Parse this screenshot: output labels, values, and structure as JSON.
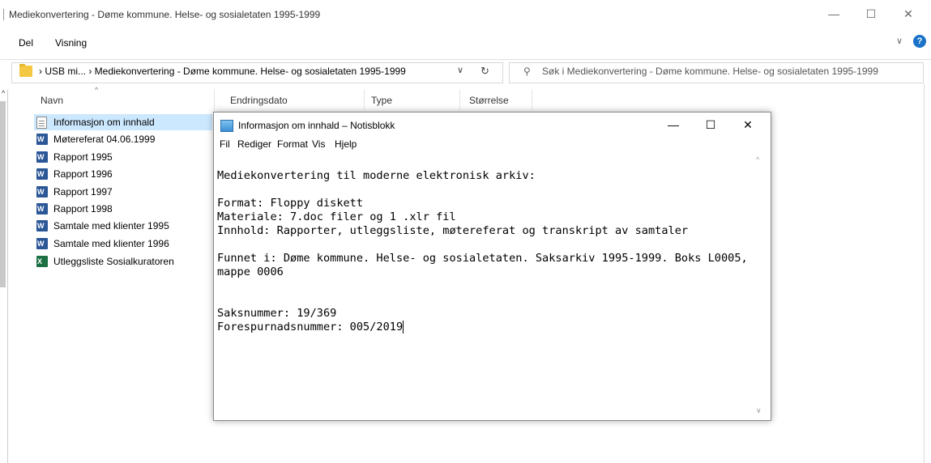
{
  "explorer": {
    "title": "Mediekonvertering - Døme kommune. Helse- og sosialetaten 1995-1999",
    "ribbon_tabs": [
      "Del",
      "Visning"
    ],
    "address": {
      "path_text": "›  USB mi...  ›  Mediekonvertering - Døme kommune. Helse- og sosialetaten 1995-1999"
    },
    "search": {
      "placeholder": "Søk i Mediekonvertering - Døme kommune. Helse- og sosialetaten 1995-1999"
    },
    "columns": [
      "Navn",
      "Endringsdato",
      "Type",
      "Størrelse"
    ],
    "files": [
      {
        "name": "Informasjon om innhald",
        "icon": "text-file-icon",
        "selected": true
      },
      {
        "name": "Møtereferat 04.06.1999",
        "icon": "word-document-icon"
      },
      {
        "name": "Rapport 1995",
        "icon": "word-document-icon"
      },
      {
        "name": "Rapport 1996",
        "icon": "word-document-icon"
      },
      {
        "name": "Rapport 1997",
        "icon": "word-document-icon"
      },
      {
        "name": "Rapport 1998",
        "icon": "word-document-icon"
      },
      {
        "name": "Samtale med klienter 1995",
        "icon": "word-document-icon"
      },
      {
        "name": "Samtale med klienter 1996",
        "icon": "word-document-icon"
      },
      {
        "name": "Utleggsliste Sosialkuratoren",
        "icon": "excel-file-icon"
      }
    ]
  },
  "notepad": {
    "title": "Informasjon om innhald – Notisblokk",
    "menu": [
      "Fil",
      "Rediger",
      "Format",
      "Vis",
      "Hjelp"
    ],
    "lines": [
      "Mediekonvertering til moderne elektronisk arkiv:",
      "",
      "Format: Floppy diskett",
      "Materiale: 7.doc filer og 1 .xlr fil",
      "Innhold: Rapporter, utleggsliste, møtereferat og transkript av samtaler",
      "",
      "Funnet i: Døme kommune. Helse- og sosialetaten. Saksarkiv 1995-1999. Boks L0005,",
      "mappe 0006",
      "",
      "",
      "Saksnummer: 19/369",
      "Forespurnadsnummer: 005/2019"
    ]
  },
  "colors": {
    "selection": "#cce8ff",
    "help_blue": "#1a73c8"
  }
}
